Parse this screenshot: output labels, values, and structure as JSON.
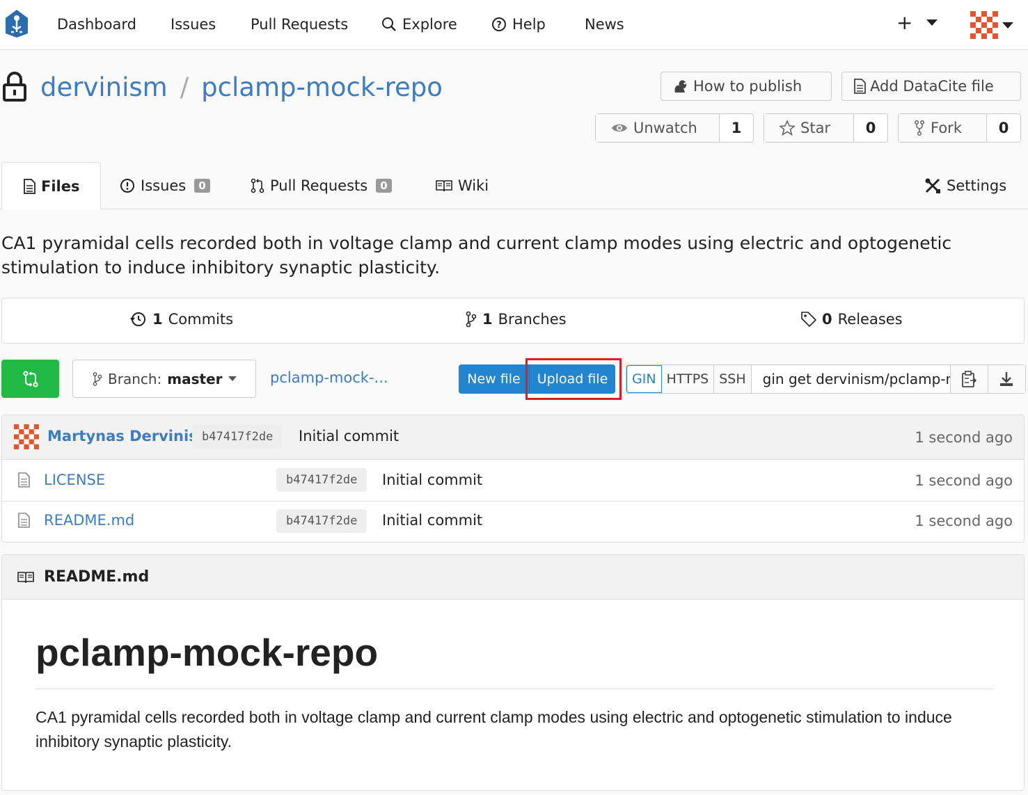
{
  "nav": {
    "dashboard": "Dashboard",
    "issues": "Issues",
    "pull_requests": "Pull Requests",
    "explore": "Explore",
    "help": "Help",
    "news": "News",
    "plus": "+"
  },
  "repo": {
    "owner": "dervinism",
    "separator": "/",
    "name": "pclamp-mock-repo",
    "how_to_publish": "How to publish",
    "add_datacite": "Add DataCite file",
    "unwatch_label": "Unwatch",
    "unwatch_count": "1",
    "star_label": "Star",
    "star_count": "0",
    "fork_label": "Fork",
    "fork_count": "0"
  },
  "tabs": {
    "files": "Files",
    "issues": "Issues",
    "issues_count": "0",
    "pull_requests": "Pull Requests",
    "pull_requests_count": "0",
    "wiki": "Wiki",
    "settings": "Settings"
  },
  "description": "CA1 pyramidal cells recorded both in voltage clamp and current clamp modes using electric and optogenetic stimulation to induce inhibitory synaptic plasticity.",
  "stats": {
    "commits_num": "1",
    "commits_label": "Commits",
    "branches_num": "1",
    "branches_label": "Branches",
    "releases_num": "0",
    "releases_label": "Releases"
  },
  "toolbar": {
    "branch_prefix": "Branch:",
    "branch_name": "master",
    "path": "pclamp-mock-...",
    "new_file": "New file",
    "upload_file": "Upload file",
    "proto_gin": "GIN",
    "proto_https": "HTTPS",
    "proto_ssh": "SSH",
    "clone_url": "gin get dervinism/pclamp-mock-repo"
  },
  "latest_commit": {
    "author": "Martynas Dervinis",
    "sha": "b47417f2de",
    "message": "Initial commit",
    "time": "1 second ago"
  },
  "files": [
    {
      "name": "LICENSE",
      "sha": "b47417f2de",
      "message": "Initial commit",
      "time": "1 second ago"
    },
    {
      "name": "README.md",
      "sha": "b47417f2de",
      "message": "Initial commit",
      "time": "1 second ago"
    }
  ],
  "readme": {
    "filename": "README.md",
    "heading": "pclamp-mock-repo",
    "body": "CA1 pyramidal cells recorded both in voltage clamp and current clamp modes using electric and optogenetic stimulation to induce inhibitory synaptic plasticity."
  },
  "colors": {
    "accent": "#2185d0",
    "link": "#3b7cc4",
    "green": "#21ba45",
    "highlight": "#e01b24"
  }
}
